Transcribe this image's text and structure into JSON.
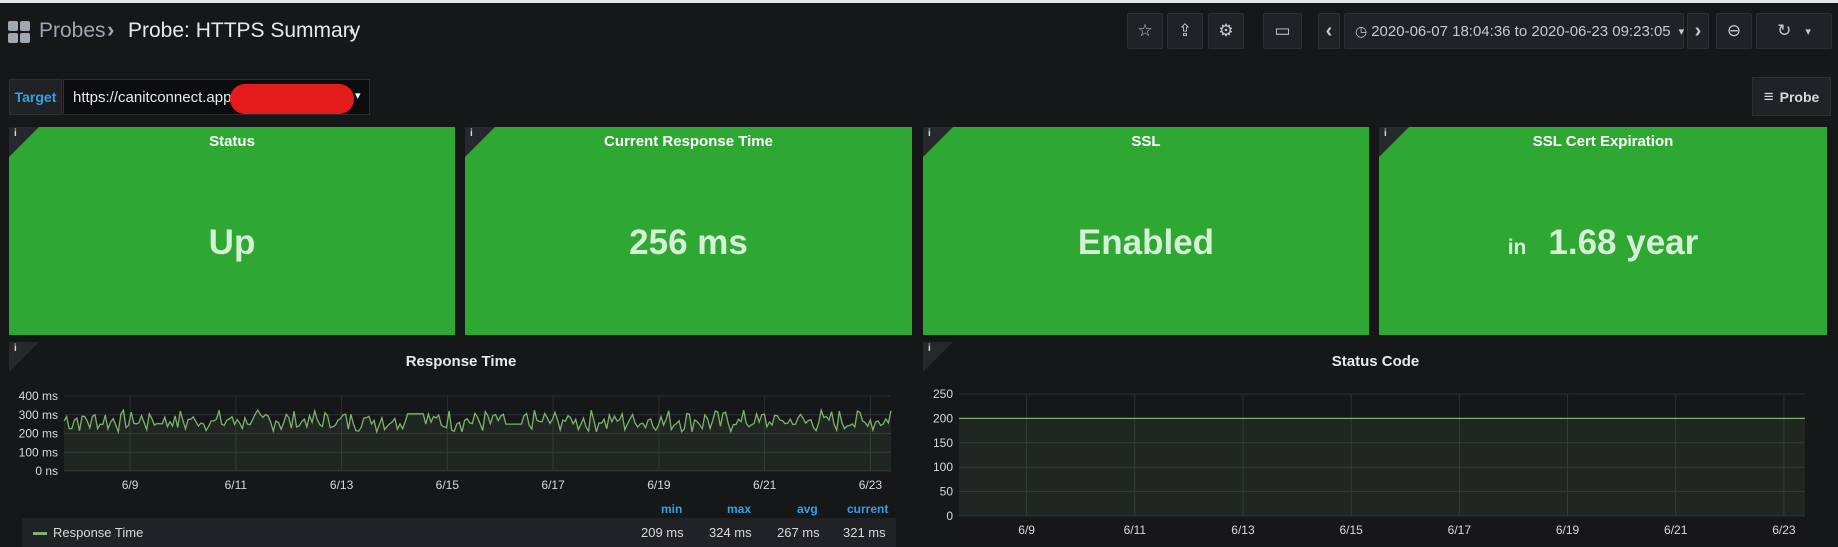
{
  "nav": {
    "breadcrumb_root": "Probes",
    "separator": "›",
    "dashboard_title": "Probe: HTTPS Summary",
    "title_caret": "▾"
  },
  "toolbar": {
    "star_icon": "☆",
    "share_icon": "⇪",
    "settings_icon": "⚙",
    "tv_icon": "▭",
    "prev_icon": "‹",
    "next_icon": "›",
    "clock_icon": "◷",
    "time_range": "2020-06-07 18:04:36 to 2020-06-23 09:23:05",
    "time_caret": "▾",
    "zoom_icon": "⊖",
    "refresh_icon": "↻",
    "refresh_caret": "▾"
  },
  "variables": {
    "target_label": "Target",
    "target_value": "https://canitconnect.app",
    "target_caret": "▾",
    "probe_button": "Probe",
    "probe_icon": "≡"
  },
  "stats": [
    {
      "title": "Status",
      "prefix": "",
      "value": "Up",
      "color": "#2fa833"
    },
    {
      "title": "Current Response Time",
      "prefix": "",
      "value": "256 ms",
      "color": "#2fa833"
    },
    {
      "title": "SSL",
      "prefix": "",
      "value": "Enabled",
      "color": "#2fa833"
    },
    {
      "title": "SSL Cert Expiration",
      "prefix": "in",
      "value": "1.68 year",
      "color": "#2fa833"
    }
  ],
  "info_icon": "i",
  "response_panel": {
    "title": "Response Time",
    "legend_headers": {
      "min": "min",
      "max": "max",
      "avg": "avg",
      "current": "current"
    },
    "legend_series": "Response Time",
    "legend_values": {
      "min": "209 ms",
      "max": "324 ms",
      "avg": "267 ms",
      "current": "321 ms"
    }
  },
  "status_panel": {
    "title": "Status Code"
  },
  "chart_data": [
    {
      "type": "line",
      "title": "Response Time",
      "ylim": [
        0,
        400
      ],
      "y_ticks": [
        "0 ns",
        "100 ms",
        "200 ms",
        "300 ms",
        "400 ms"
      ],
      "x_ticks": [
        "6/9",
        "6/11",
        "6/13",
        "6/15",
        "6/17",
        "6/19",
        "6/21",
        "6/23"
      ],
      "xlim": [
        7.75,
        23.39
      ],
      "grid": true,
      "legend": "bottom-table",
      "series": [
        {
          "name": "Response Time",
          "color": "#7eb26d",
          "stats": {
            "min": 209,
            "max": 324,
            "avg": 267,
            "current": 321
          }
        }
      ]
    },
    {
      "type": "area",
      "title": "Status Code",
      "ylim": [
        0,
        250
      ],
      "y_ticks": [
        "0",
        "50",
        "100",
        "150",
        "200",
        "250"
      ],
      "x_ticks": [
        "6/9",
        "6/11",
        "6/13",
        "6/15",
        "6/17",
        "6/19",
        "6/21",
        "6/23"
      ],
      "xlim": [
        7.75,
        23.39
      ],
      "grid": true,
      "series": [
        {
          "color": "#7eb26d",
          "x": [
            7.75,
            23.39
          ],
          "values": [
            200,
            200
          ]
        }
      ]
    }
  ]
}
